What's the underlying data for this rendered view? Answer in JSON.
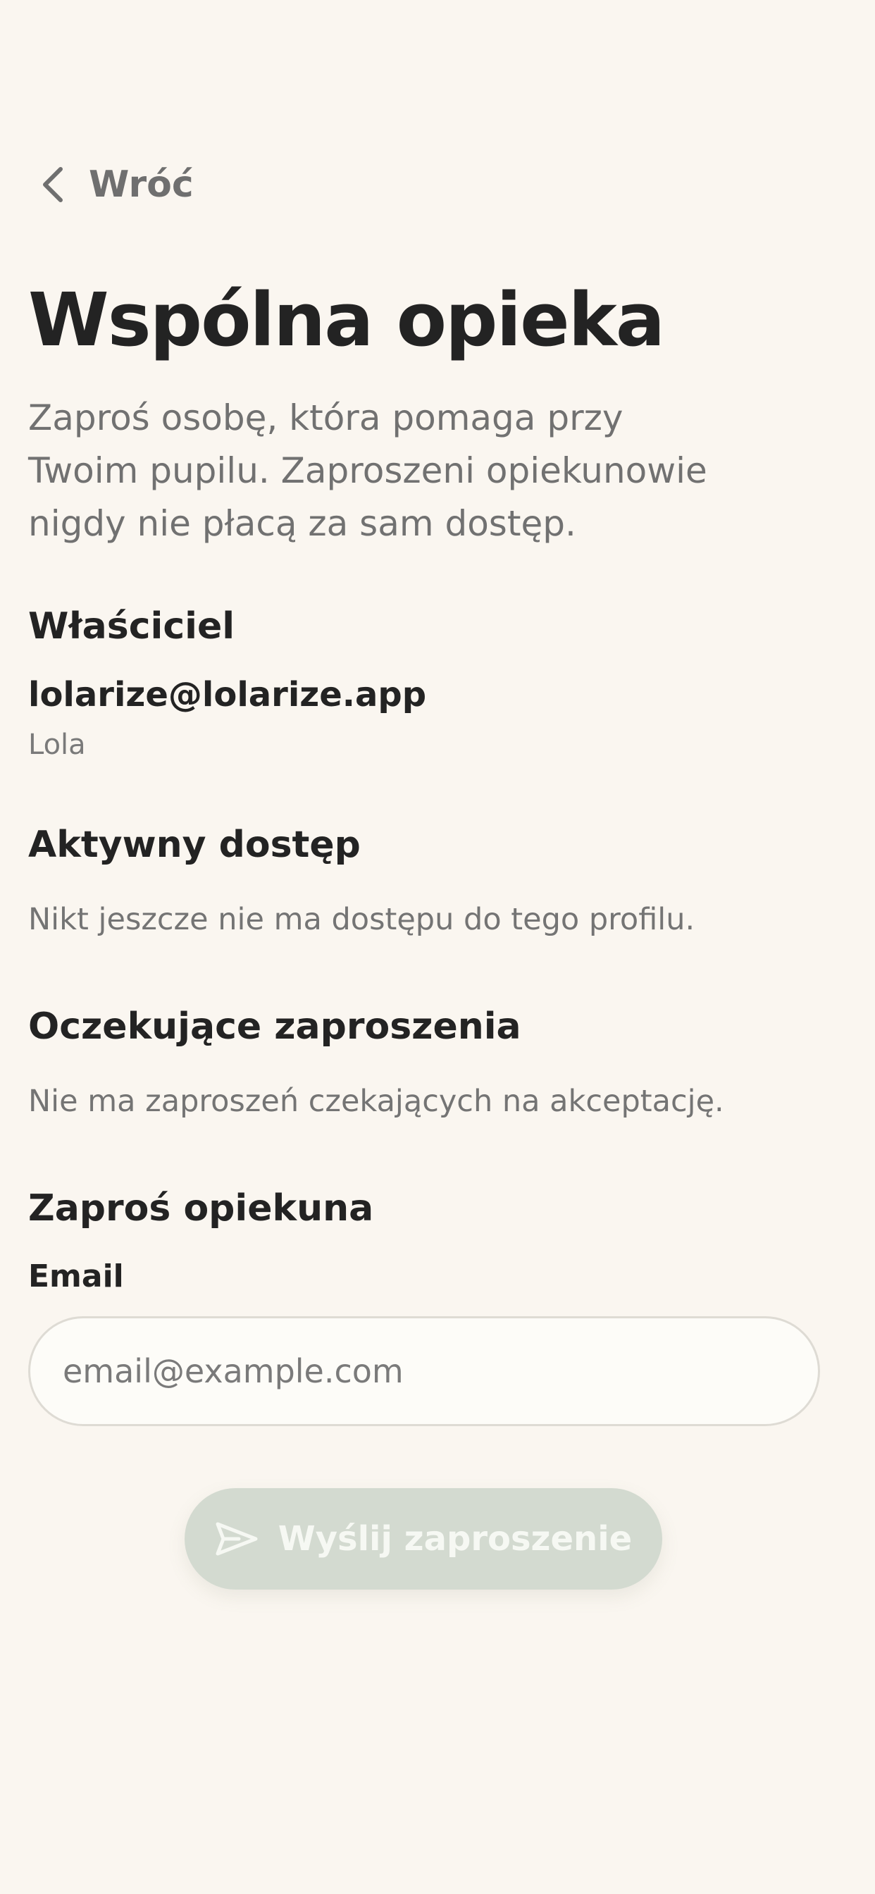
{
  "nav": {
    "back_label": "Wróć",
    "back_icon": "chevron-left-icon"
  },
  "page": {
    "title": "Wspólna opieka",
    "intro": "Zaproś osobę, która pomaga przy Twoim pupilu. Zaproszeni opiekunowie nigdy nie płacą za sam dostęp."
  },
  "owner": {
    "heading": "Właściciel",
    "email": "lolarize@lolarize.app",
    "name": "Lola"
  },
  "active_access": {
    "heading": "Aktywny dostęp",
    "empty_text": "Nikt jeszcze nie ma dostępu do tego profilu."
  },
  "pending_invites": {
    "heading": "Oczekujące zaproszenia",
    "empty_text": "Nie ma zaproszeń czekających na akceptację."
  },
  "invite": {
    "heading": "Zaproś opiekuna",
    "email_label": "Email",
    "email_value": "",
    "email_placeholder": "email@example.com",
    "send_label": "Wyślij zaproszenie",
    "send_icon": "send-icon",
    "send_disabled": true
  },
  "colors": {
    "background": "#faf6f0",
    "text_primary": "#232323",
    "text_muted": "#747474",
    "button_disabled_bg": "#d3dad0",
    "button_disabled_text": "#f6f8f3"
  }
}
